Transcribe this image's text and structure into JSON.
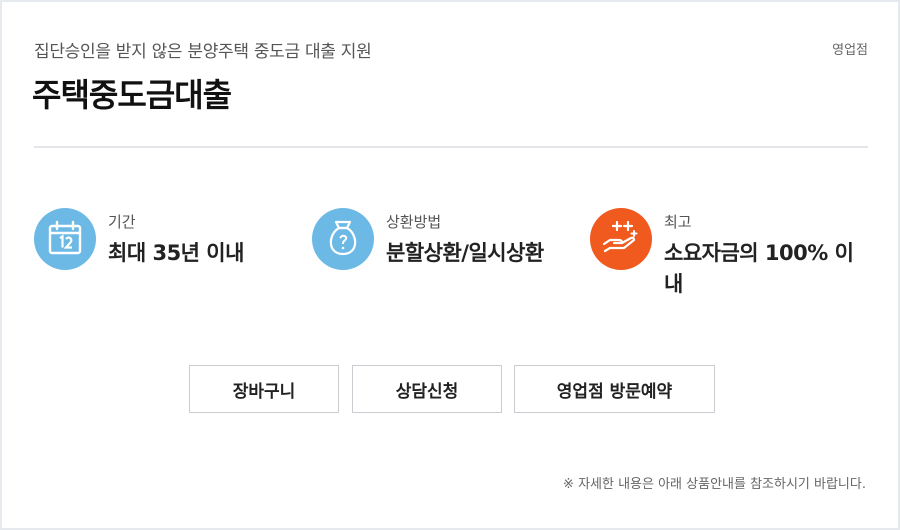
{
  "header": {
    "subtitle": "집단승인을 받지 않은 분양주택 중도금 대출 지원",
    "channel": "영업점",
    "title": "주택중도금대출"
  },
  "info": [
    {
      "icon": "calendar-icon",
      "label": "기간",
      "value": "최대 35년 이내",
      "color": "#6cb9e6"
    },
    {
      "icon": "money-bag-icon",
      "label": "상환방법",
      "value": "분할상환/일시상환",
      "color": "#6cb9e6"
    },
    {
      "icon": "hand-sparkle-icon",
      "label": "최고",
      "value": "소요자금의 100% 이내",
      "color": "#f15a1f"
    }
  ],
  "buttons": {
    "cart": "장바구니",
    "consult": "상담신청",
    "visit": "영업점 방문예약"
  },
  "note": "※ 자세한 내용은 아래 상품안내를 참조하시기 바랍니다."
}
